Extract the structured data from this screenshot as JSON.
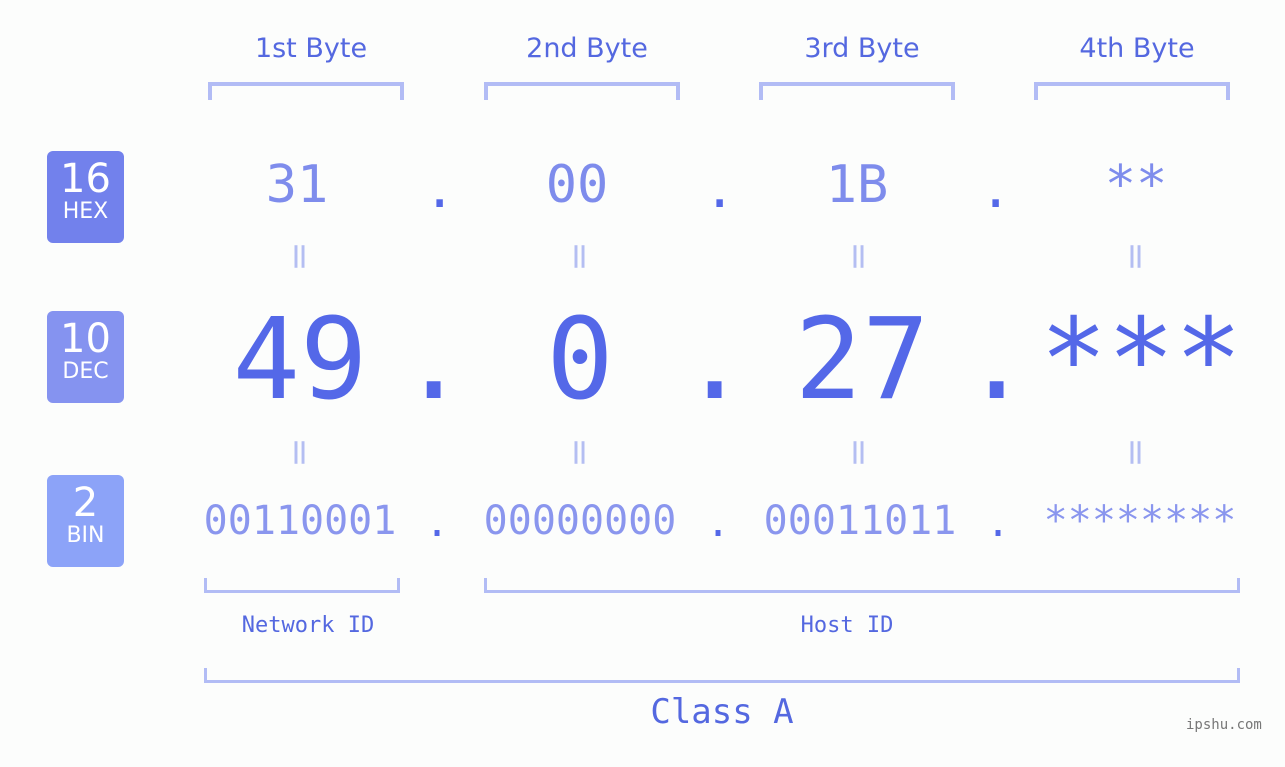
{
  "headers": [
    "1st Byte",
    "2nd Byte",
    "3rd Byte",
    "4th Byte"
  ],
  "badges": {
    "hex": {
      "num": "16",
      "label": "HEX",
      "color": "#7281ec"
    },
    "dec": {
      "num": "10",
      "label": "DEC",
      "color": "#8593f0"
    },
    "bin": {
      "num": "2",
      "label": "BIN",
      "color": "#8ca3f8"
    }
  },
  "hex": [
    "31",
    "00",
    "1B",
    "**"
  ],
  "dec": [
    "49",
    "0",
    "27",
    "***"
  ],
  "bin": [
    "00110001",
    "00000000",
    "00011011",
    "********"
  ],
  "separator": ".",
  "equals": "=",
  "network_label": "Network ID",
  "host_label": "Host ID",
  "class_label": "Class A",
  "watermark": "ipshu.com"
}
